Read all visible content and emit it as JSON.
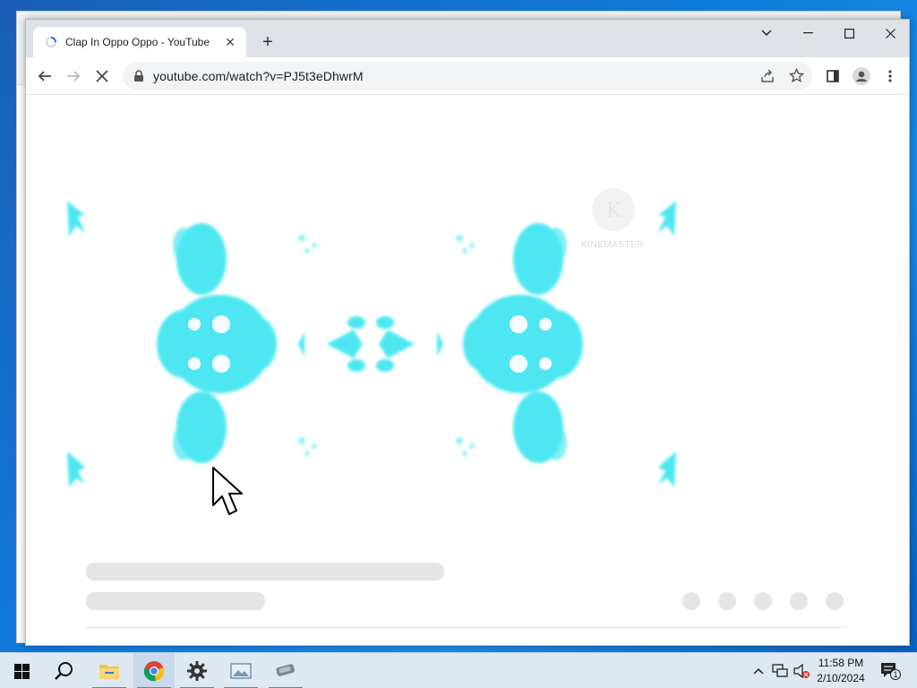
{
  "browser": {
    "tab": {
      "title": "Clap In Oppo Oppo - YouTube",
      "close_glyph": "✕"
    },
    "new_tab_glyph": "+",
    "window_controls": {
      "tab_search": "⌄",
      "minimize": "—",
      "maximize": "☐",
      "close": "✕"
    },
    "toolbar": {
      "url": "youtube.com/watch?v=PJ5t3eDhwrM",
      "loading": true
    }
  },
  "video": {
    "watermark_letter": "K",
    "watermark_text": "KINEMASTER",
    "accent_color": "#3fe6f0"
  },
  "taskbar": {
    "apps": [
      "windows-start",
      "search",
      "file-explorer",
      "chrome",
      "settings",
      "photo-viewer",
      "tablet-device"
    ],
    "clock": {
      "time": "11:58 PM",
      "date": "2/10/2024"
    },
    "notification_count": "1"
  }
}
